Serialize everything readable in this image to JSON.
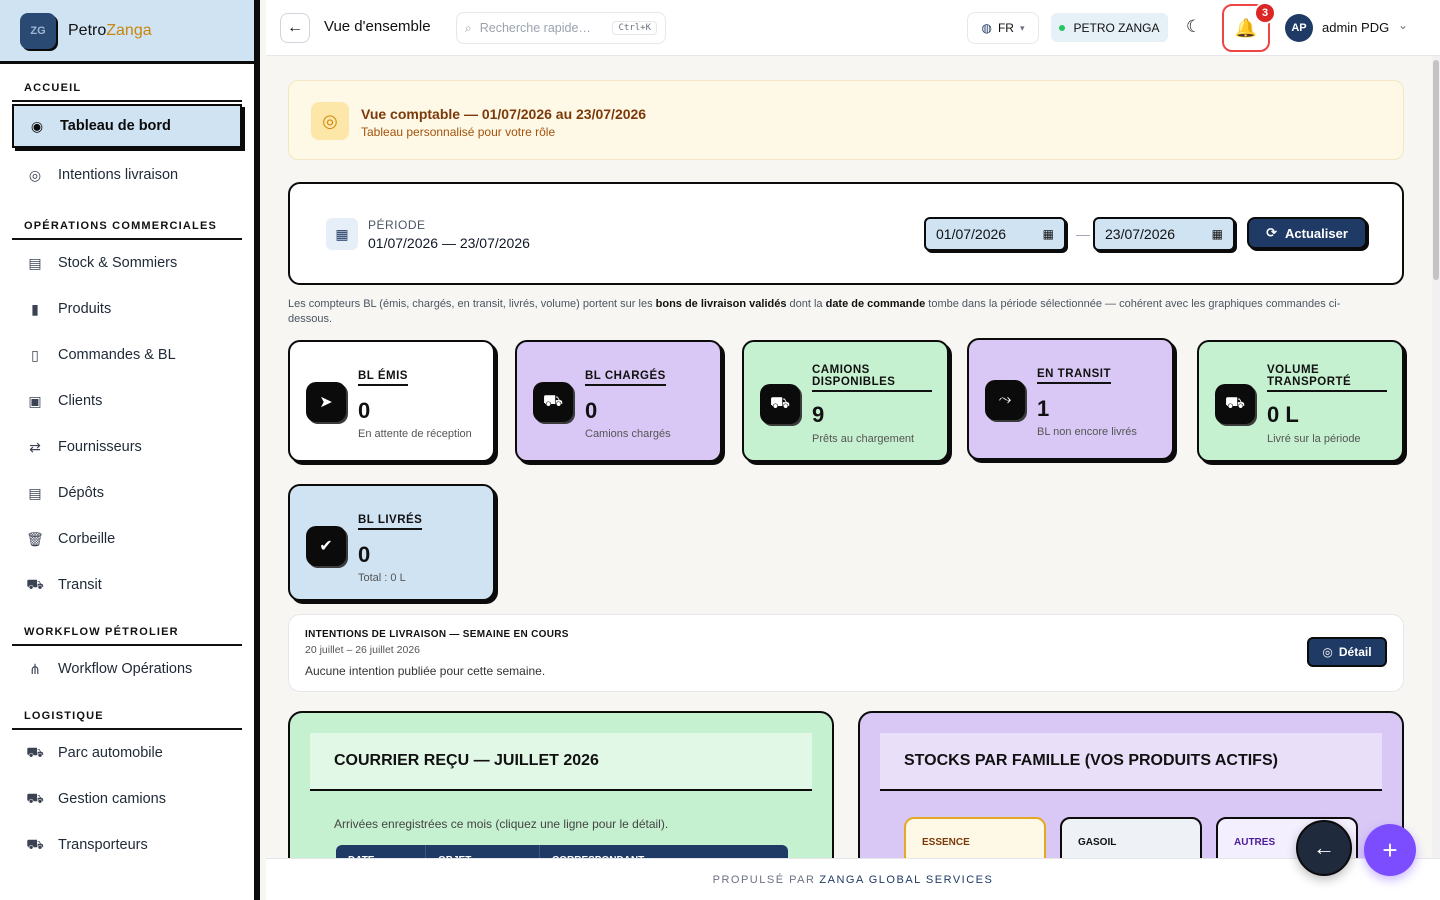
{
  "brand": {
    "logo_text": "ZG",
    "name_part1": "Petro",
    "name_part2": "Zanga"
  },
  "sidebar": {
    "sections": [
      {
        "title": "ACCUEIL",
        "items": [
          "Tableau de bord",
          "Intentions livraison"
        ]
      },
      {
        "title": "OPÉRATIONS COMMERCIALES",
        "items": [
          "Stock & Sommiers",
          "Produits",
          "Commandes & BL",
          "Clients",
          "Fournisseurs",
          "Dépôts",
          "Corbeille",
          "Transit"
        ]
      },
      {
        "title": "WORKFLOW PÉTROLIER",
        "items": [
          "Workflow Opérations"
        ]
      },
      {
        "title": "LOGISTIQUE",
        "items": [
          "Parc automobile",
          "Gestion camions",
          "Transporteurs"
        ]
      }
    ],
    "active_item": "Tableau de bord"
  },
  "topbar": {
    "page_title": "Vue d'ensemble",
    "search_placeholder": "Recherche rapide…",
    "search_shortcut": "Ctrl+K",
    "language": "FR",
    "company": "PETRO ZANGA",
    "notifications_count": "3",
    "user_initials": "AP",
    "user_name": "admin PDG"
  },
  "banner": {
    "title": "Vue comptable — 01/07/2026 au 23/07/2026",
    "subtitle": "Tableau personnalisé pour votre rôle"
  },
  "period": {
    "label": "PÉRIODE",
    "value": "01/07/2026 — 23/07/2026",
    "date_from": "01/07/2026",
    "date_to": "23/07/2026",
    "separator": "—",
    "refresh_label": "Actualiser"
  },
  "note": {
    "part1": "Les compteurs BL (émis, chargés, en transit, livrés, volume) portent sur les ",
    "bold1": "bons de livraison validés",
    "part2": " dont la ",
    "bold2": "date de commande",
    "part3": " tombe dans la période sélectionnée — cohérent avec les graphiques commandes ci-dessous."
  },
  "kpis": [
    {
      "label": "BL ÉMIS",
      "value": "0",
      "sub": "En attente de réception",
      "color": "#ffffff",
      "icon": "send-icon"
    },
    {
      "label": "BL CHARGÉS",
      "value": "0",
      "sub": "Camions chargés",
      "color": "#d9c8f5",
      "icon": "truck-loading-icon"
    },
    {
      "label": "CAMIONS DISPONIBLES",
      "value": "9",
      "sub": "Prêts au chargement",
      "color": "#c6f1d0",
      "icon": "truck-icon"
    },
    {
      "label": "EN TRANSIT",
      "value": "1",
      "sub": "BL non encore livrés",
      "color": "#d9c8f5",
      "icon": "route-icon"
    },
    {
      "label": "VOLUME TRANSPORTÉ",
      "value": "0 L",
      "sub": "Livré sur la période",
      "color": "#c6f1d0",
      "icon": "truck-icon"
    },
    {
      "label": "BL LIVRÉS",
      "value": "0",
      "sub": "Total : 0 L",
      "color": "#cfe3f3",
      "icon": "check-circle-icon"
    }
  ],
  "intentions": {
    "title": "INTENTIONS DE LIVRAISON — SEMAINE EN COURS",
    "dates": "20 juillet – 26 juillet 2026",
    "empty": "Aucune intention publiée pour cette semaine.",
    "detail_label": "Détail"
  },
  "mail_card": {
    "title": "COURRIER REÇU — JUILLET 2026",
    "description": "Arrivées enregistrées ce mois (cliquez une ligne pour le détail).",
    "columns": [
      "DATE",
      "OBJET",
      "CORRESPONDANT"
    ]
  },
  "stock_card": {
    "title": "STOCKS PAR FAMILLE (VOS PRODUITS ACTIFS)",
    "families": [
      "ESSENCE",
      "GASOIL",
      "AUTRES"
    ]
  },
  "footer": {
    "powered_by": "PROPULSÉ PAR",
    "company": "ZANGA GLOBAL SERVICES"
  },
  "colors": {
    "primary": "#1f3a64",
    "accent": "#c8860d",
    "fab": "#7c4dff",
    "badge": "#dc2626"
  }
}
